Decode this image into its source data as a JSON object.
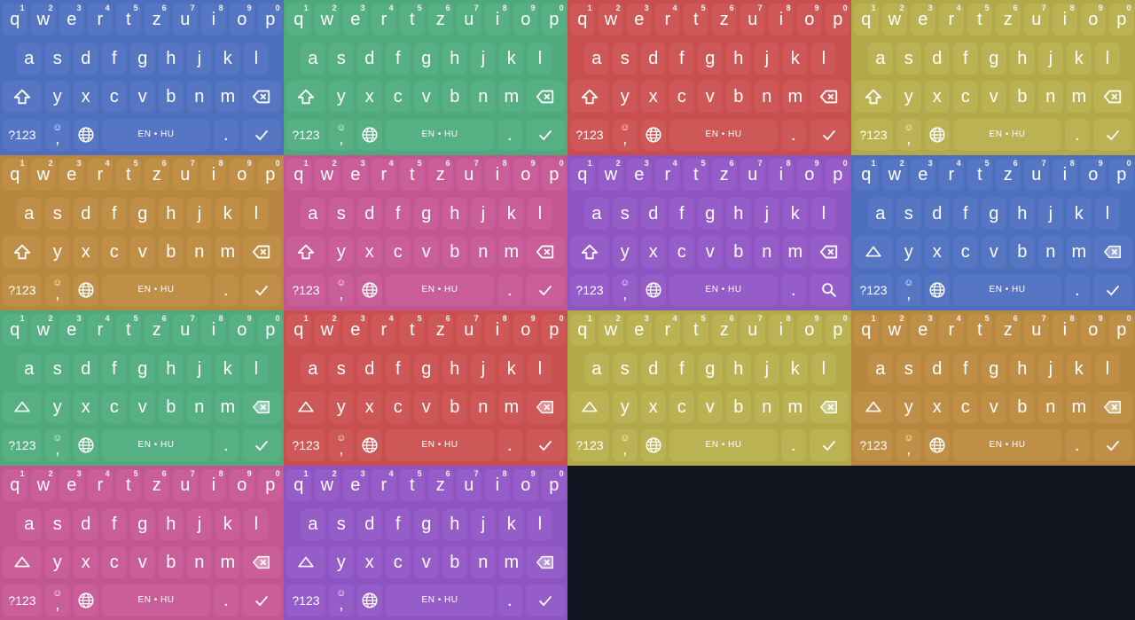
{
  "keyboard": {
    "row1": [
      {
        "label": "q",
        "hint": "1"
      },
      {
        "label": "w",
        "hint": "2"
      },
      {
        "label": "e",
        "hint": "3"
      },
      {
        "label": "r",
        "hint": "4"
      },
      {
        "label": "t",
        "hint": "5"
      },
      {
        "label": "z",
        "hint": "6"
      },
      {
        "label": "u",
        "hint": "7"
      },
      {
        "label": "i",
        "hint": "8"
      },
      {
        "label": "o",
        "hint": "9"
      },
      {
        "label": "p",
        "hint": "0"
      }
    ],
    "row2": [
      "a",
      "s",
      "d",
      "f",
      "g",
      "h",
      "j",
      "k",
      "l"
    ],
    "row3": [
      "y",
      "x",
      "c",
      "v",
      "b",
      "n",
      "m"
    ],
    "symbols_label": "?123",
    "comma_label": ",",
    "emoji_label": "☺",
    "period_label": ".",
    "language_label": "EN • HU"
  },
  "variants": [
    {
      "name": "blue",
      "bg": "#4e6fbd",
      "key": "#5676c3",
      "shift": "filled",
      "action": "check"
    },
    {
      "name": "green",
      "bg": "#4fa97a",
      "key": "#56b083",
      "shift": "filled",
      "action": "check"
    },
    {
      "name": "red",
      "bg": "#c94f4f",
      "key": "#ce5757",
      "shift": "filled",
      "action": "check"
    },
    {
      "name": "yellow",
      "bg": "#b2a94a",
      "key": "#bbb254",
      "shift": "filled",
      "action": "check"
    },
    {
      "name": "orange",
      "bg": "#b8873f",
      "key": "#c08f47",
      "shift": "filled",
      "action": "check"
    },
    {
      "name": "pink",
      "bg": "#c25690",
      "key": "#c95e98",
      "shift": "filled",
      "action": "check"
    },
    {
      "name": "purple",
      "bg": "#8e55c2",
      "key": "#965dc9",
      "shift": "filled",
      "action": "search"
    },
    {
      "name": "blue",
      "bg": "#4e6fbd",
      "key": "#5676c3",
      "shift": "outline",
      "action": "check"
    },
    {
      "name": "green",
      "bg": "#4fa97a",
      "key": "#56b083",
      "shift": "outline",
      "action": "check"
    },
    {
      "name": "red",
      "bg": "#c94f4f",
      "key": "#ce5757",
      "shift": "outline",
      "action": "check"
    },
    {
      "name": "yellow",
      "bg": "#b2a94a",
      "key": "#bbb254",
      "shift": "outline",
      "action": "check"
    },
    {
      "name": "orange",
      "bg": "#b8873f",
      "key": "#c08f47",
      "shift": "outline",
      "action": "check"
    },
    {
      "name": "pink",
      "bg": "#c25690",
      "key": "#c95e98",
      "shift": "outline",
      "action": "check"
    },
    {
      "name": "purple",
      "bg": "#8e55c2",
      "key": "#965dc9",
      "shift": "outline",
      "action": "check"
    }
  ],
  "icons": {
    "shift": "shift-icon",
    "backspace": "backspace-icon",
    "globe": "globe-icon",
    "check": "check-icon",
    "search": "search-icon"
  }
}
